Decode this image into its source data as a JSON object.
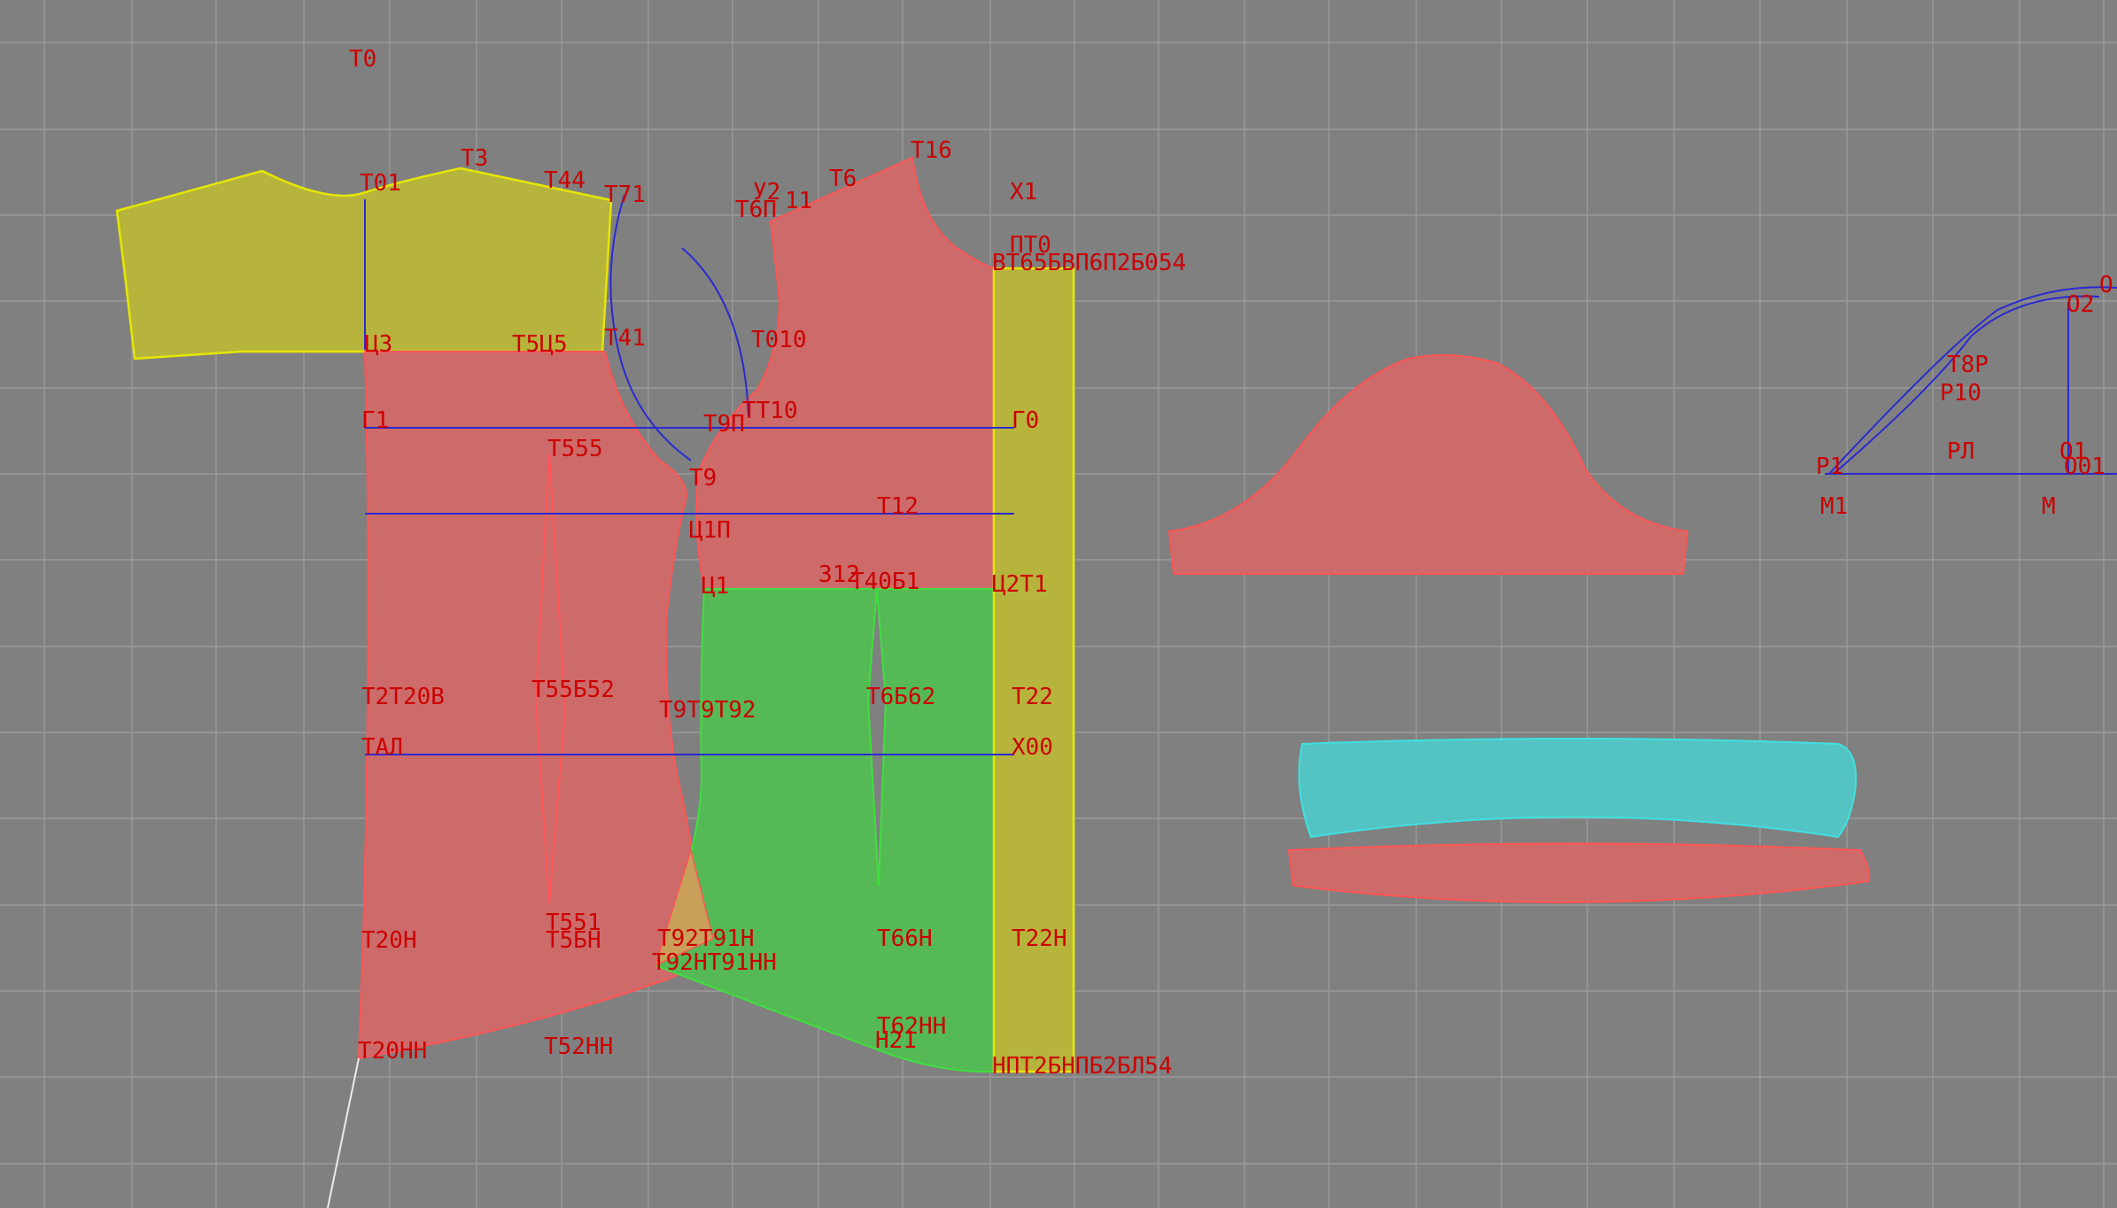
{
  "colors": {
    "background": "#808080",
    "grid": "#9a9a9a",
    "label": "#cc0000",
    "yellow_fill": "#b6b43c",
    "red_fill": "#cd6b6b",
    "green_fill": "#55b955",
    "cyan_fill": "#54c3c3",
    "outline_red": "#ff5555",
    "outline_green": "#3ee03e",
    "outline_yellow": "#e6e600",
    "construction_blue": "#2a2ad0",
    "point_green": "#009900"
  },
  "labels": {
    "t0": "Т0",
    "t01": "Т01",
    "t3": "Т3",
    "t44": "Т44",
    "t71": "Т71",
    "t16": "Т16",
    "y2": "У2",
    "t6": "Т6",
    "t6p": "Т6П",
    "t11": "11",
    "x1": "Х1",
    "pt0": "ПТ0",
    "vt": "ВТ65БВП6П2Б054",
    "ts3": "Ц3",
    "t5u5": "Т5Ц5",
    "t41": "Т41",
    "t010": "Т010",
    "g1": "Г1",
    "t9p": "Т9П",
    "tt10": "ТТ10",
    "g0": "Г0",
    "t555": "Т555",
    "t9": "Т9",
    "t12": "Т12",
    "tsp": "Ц1П",
    "t312": "312",
    "t40": "Т40Б1",
    "u2t1": "Ц2Т1",
    "u1": "Ц1",
    "t20v": "Т2Т20В",
    "t552": "Т55Б52",
    "t992": "Т9Т9Т92",
    "t662": "Т6Б62",
    "t22": "Т22",
    "tal": "ТАЛ",
    "x00": "Х00",
    "t551": "Т551",
    "t20h": "Т20Н",
    "t5bh": "Т5БН",
    "t92h": "Т92Т91Н",
    "t66h": "Т66Н",
    "t22h": "Т22Н",
    "t92hh": "Т92НТ91НН",
    "t62hh": "Т62НН",
    "h21": "Н21",
    "t20hh": "Т20НН",
    "t52hh": "Т52НН",
    "hbot": "НПТ2БНПБ2БЛ54",
    "t8p": "Т8Р",
    "r10": "Р10",
    "o2": "О2",
    "o": "О",
    "r1": "Р1",
    "rl": "РЛ",
    "o1": "О1",
    "o01": "О01",
    "m1": "М1",
    "m": "М"
  }
}
